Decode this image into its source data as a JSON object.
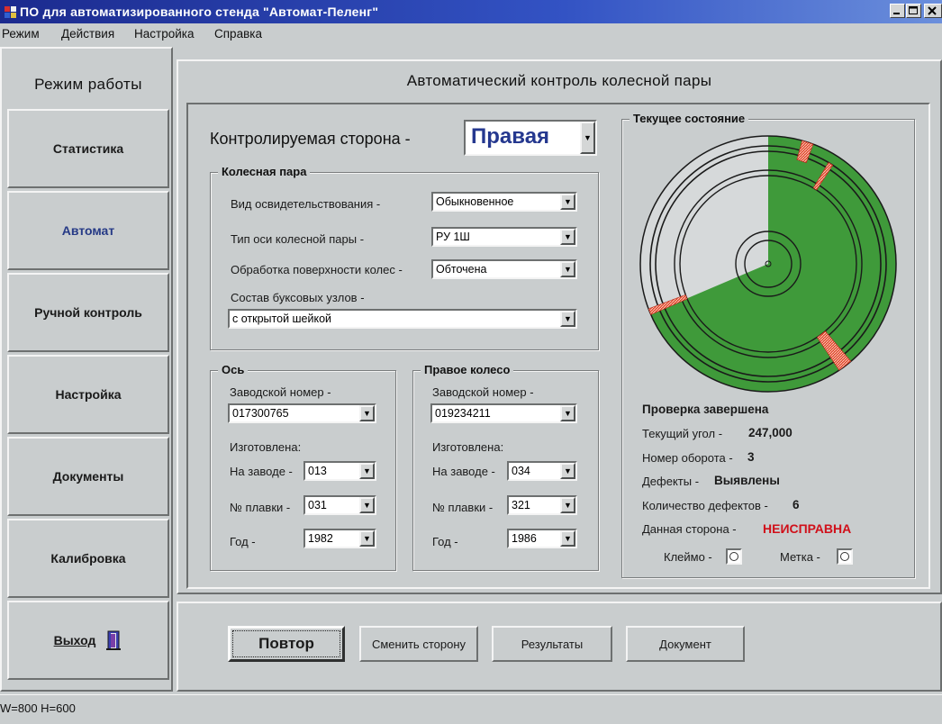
{
  "window": {
    "title": "ПО для автоматизированного стенда \"Автомат-Пеленг\""
  },
  "menu": [
    "Режим",
    "Действия",
    "Настройка",
    "Справка"
  ],
  "sidebar": {
    "title": "Режим работы",
    "items": [
      {
        "label": "Статистика"
      },
      {
        "label": "Автомат",
        "active": true
      },
      {
        "label": "Ручной контроль"
      },
      {
        "label": "Настройка"
      },
      {
        "label": "Документы"
      },
      {
        "label": "Калибровка"
      },
      {
        "label": "Выход"
      }
    ],
    "exit_icon": "exit-door-icon"
  },
  "main": {
    "title": "Автоматический контроль колесной пары",
    "side_label": "Контролируемая сторона -",
    "side_value": "Правая",
    "wheelset": {
      "title": "Колесная пара",
      "inspection_label": "Вид освидетельствования -",
      "inspection_value": "Обыкновенное",
      "axle_type_label": "Тип оси колесной пары -",
      "axle_type_value": "РУ 1Ш",
      "surface_label": "Обработка поверхности колес -",
      "surface_value": "Обточена",
      "bearing_label": "Состав буксовых узлов -",
      "bearing_value": "с открытой шейкой"
    },
    "axle": {
      "title": "Ось",
      "serial_label": "Заводской номер -",
      "serial_value": "017300765",
      "made_label": "Изготовлена:",
      "plant_label": "На заводе -",
      "plant_value": "013",
      "melt_label": "№ плавки -",
      "melt_value": "031",
      "year_label": "Год -",
      "year_value": "1982"
    },
    "wheel": {
      "title": "Правое колесо",
      "serial_label": "Заводской номер -",
      "serial_value": "019234211",
      "made_label": "Изготовлена:",
      "plant_label": "На заводе -",
      "plant_value": "034",
      "melt_label": "№ плавки -",
      "melt_value": "321",
      "year_label": "Год -",
      "year_value": "1986"
    },
    "state": {
      "title": "Текущее состояние",
      "progress_fraction": 0.686,
      "status": "Проверка завершена",
      "angle_label": "Текущий угол -",
      "angle_value": "247,000",
      "turn_label": "Номер оборота -",
      "turn_value": "3",
      "defects_label": "Дефекты -",
      "defects_value": "Выявлены",
      "defect_count_label": "Количество дефектов -",
      "defect_count_value": "6",
      "side_label": "Данная сторона -",
      "side_value": "НЕИСПРАВНА",
      "stamp_label": "Клеймо -",
      "mark_label": "Метка -"
    }
  },
  "actions": {
    "repeat": "Повтор",
    "switch_side": "Сменить сторону",
    "results": "Результаты",
    "document": "Документ"
  },
  "status_bar": "W=800 H=600",
  "colors": {
    "title_bar": "#1b2a8e",
    "disk_green": "#3f9a3a",
    "disk_light": "#d6d9da",
    "defect": "#d23a2a",
    "fault_text": "#d0101a",
    "active_item": "#263a86"
  }
}
